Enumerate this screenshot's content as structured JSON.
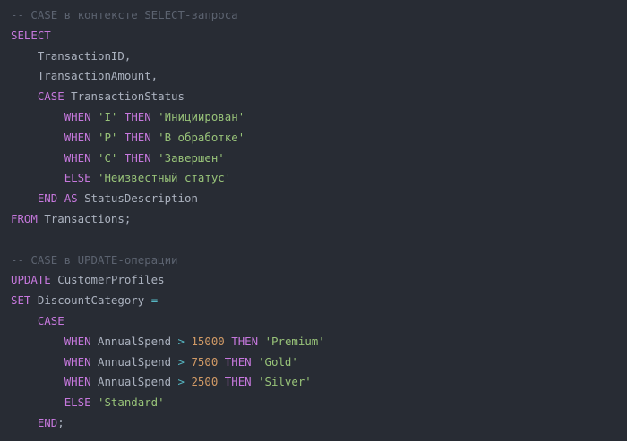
{
  "editor": {
    "language": "sql",
    "colors": {
      "background": "#282c34",
      "comment": "#5c6370",
      "keyword": "#c678dd",
      "string": "#98c379",
      "number": "#d19a66",
      "operator": "#56b6c2",
      "ident": "#abb2bf",
      "plain": "#abb2bf",
      "ws": "#abb2bf"
    },
    "lines": [
      [
        {
          "t": "comment",
          "v": "-- CASE в контексте SELECT-запроса"
        }
      ],
      [
        {
          "t": "keyword",
          "v": "SELECT"
        }
      ],
      [
        {
          "t": "ws",
          "v": "    "
        },
        {
          "t": "ident",
          "v": "TransactionID"
        },
        {
          "t": "plain",
          "v": ","
        }
      ],
      [
        {
          "t": "ws",
          "v": "    "
        },
        {
          "t": "ident",
          "v": "TransactionAmount"
        },
        {
          "t": "plain",
          "v": ","
        }
      ],
      [
        {
          "t": "ws",
          "v": "    "
        },
        {
          "t": "keyword",
          "v": "CASE"
        },
        {
          "t": "ws",
          "v": " "
        },
        {
          "t": "ident",
          "v": "TransactionStatus"
        }
      ],
      [
        {
          "t": "ws",
          "v": "        "
        },
        {
          "t": "keyword",
          "v": "WHEN"
        },
        {
          "t": "ws",
          "v": " "
        },
        {
          "t": "string",
          "v": "'I'"
        },
        {
          "t": "ws",
          "v": " "
        },
        {
          "t": "keyword",
          "v": "THEN"
        },
        {
          "t": "ws",
          "v": " "
        },
        {
          "t": "string",
          "v": "'Инициирован'"
        }
      ],
      [
        {
          "t": "ws",
          "v": "        "
        },
        {
          "t": "keyword",
          "v": "WHEN"
        },
        {
          "t": "ws",
          "v": " "
        },
        {
          "t": "string",
          "v": "'P'"
        },
        {
          "t": "ws",
          "v": " "
        },
        {
          "t": "keyword",
          "v": "THEN"
        },
        {
          "t": "ws",
          "v": " "
        },
        {
          "t": "string",
          "v": "'В обработке'"
        }
      ],
      [
        {
          "t": "ws",
          "v": "        "
        },
        {
          "t": "keyword",
          "v": "WHEN"
        },
        {
          "t": "ws",
          "v": " "
        },
        {
          "t": "string",
          "v": "'C'"
        },
        {
          "t": "ws",
          "v": " "
        },
        {
          "t": "keyword",
          "v": "THEN"
        },
        {
          "t": "ws",
          "v": " "
        },
        {
          "t": "string",
          "v": "'Завершен'"
        }
      ],
      [
        {
          "t": "ws",
          "v": "        "
        },
        {
          "t": "keyword",
          "v": "ELSE"
        },
        {
          "t": "ws",
          "v": " "
        },
        {
          "t": "string",
          "v": "'Неизвестный статус'"
        }
      ],
      [
        {
          "t": "ws",
          "v": "    "
        },
        {
          "t": "keyword",
          "v": "END"
        },
        {
          "t": "ws",
          "v": " "
        },
        {
          "t": "keyword",
          "v": "AS"
        },
        {
          "t": "ws",
          "v": " "
        },
        {
          "t": "ident",
          "v": "StatusDescription"
        }
      ],
      [
        {
          "t": "keyword",
          "v": "FROM"
        },
        {
          "t": "ws",
          "v": " "
        },
        {
          "t": "ident",
          "v": "Transactions"
        },
        {
          "t": "plain",
          "v": ";"
        }
      ],
      [],
      [
        {
          "t": "comment",
          "v": "-- CASE в UPDATE-операции"
        }
      ],
      [
        {
          "t": "keyword",
          "v": "UPDATE"
        },
        {
          "t": "ws",
          "v": " "
        },
        {
          "t": "ident",
          "v": "CustomerProfiles"
        }
      ],
      [
        {
          "t": "keyword",
          "v": "SET"
        },
        {
          "t": "ws",
          "v": " "
        },
        {
          "t": "ident",
          "v": "DiscountCategory"
        },
        {
          "t": "ws",
          "v": " "
        },
        {
          "t": "operator",
          "v": "="
        }
      ],
      [
        {
          "t": "ws",
          "v": "    "
        },
        {
          "t": "keyword",
          "v": "CASE"
        }
      ],
      [
        {
          "t": "ws",
          "v": "        "
        },
        {
          "t": "keyword",
          "v": "WHEN"
        },
        {
          "t": "ws",
          "v": " "
        },
        {
          "t": "ident",
          "v": "AnnualSpend"
        },
        {
          "t": "ws",
          "v": " "
        },
        {
          "t": "operator",
          "v": ">"
        },
        {
          "t": "ws",
          "v": " "
        },
        {
          "t": "number",
          "v": "15000"
        },
        {
          "t": "ws",
          "v": " "
        },
        {
          "t": "keyword",
          "v": "THEN"
        },
        {
          "t": "ws",
          "v": " "
        },
        {
          "t": "string",
          "v": "'Premium'"
        }
      ],
      [
        {
          "t": "ws",
          "v": "        "
        },
        {
          "t": "keyword",
          "v": "WHEN"
        },
        {
          "t": "ws",
          "v": " "
        },
        {
          "t": "ident",
          "v": "AnnualSpend"
        },
        {
          "t": "ws",
          "v": " "
        },
        {
          "t": "operator",
          "v": ">"
        },
        {
          "t": "ws",
          "v": " "
        },
        {
          "t": "number",
          "v": "7500"
        },
        {
          "t": "ws",
          "v": " "
        },
        {
          "t": "keyword",
          "v": "THEN"
        },
        {
          "t": "ws",
          "v": " "
        },
        {
          "t": "string",
          "v": "'Gold'"
        }
      ],
      [
        {
          "t": "ws",
          "v": "        "
        },
        {
          "t": "keyword",
          "v": "WHEN"
        },
        {
          "t": "ws",
          "v": " "
        },
        {
          "t": "ident",
          "v": "AnnualSpend"
        },
        {
          "t": "ws",
          "v": " "
        },
        {
          "t": "operator",
          "v": ">"
        },
        {
          "t": "ws",
          "v": " "
        },
        {
          "t": "number",
          "v": "2500"
        },
        {
          "t": "ws",
          "v": " "
        },
        {
          "t": "keyword",
          "v": "THEN"
        },
        {
          "t": "ws",
          "v": " "
        },
        {
          "t": "string",
          "v": "'Silver'"
        }
      ],
      [
        {
          "t": "ws",
          "v": "        "
        },
        {
          "t": "keyword",
          "v": "ELSE"
        },
        {
          "t": "ws",
          "v": " "
        },
        {
          "t": "string",
          "v": "'Standard'"
        }
      ],
      [
        {
          "t": "ws",
          "v": "    "
        },
        {
          "t": "keyword",
          "v": "END"
        },
        {
          "t": "plain",
          "v": ";"
        }
      ]
    ]
  }
}
